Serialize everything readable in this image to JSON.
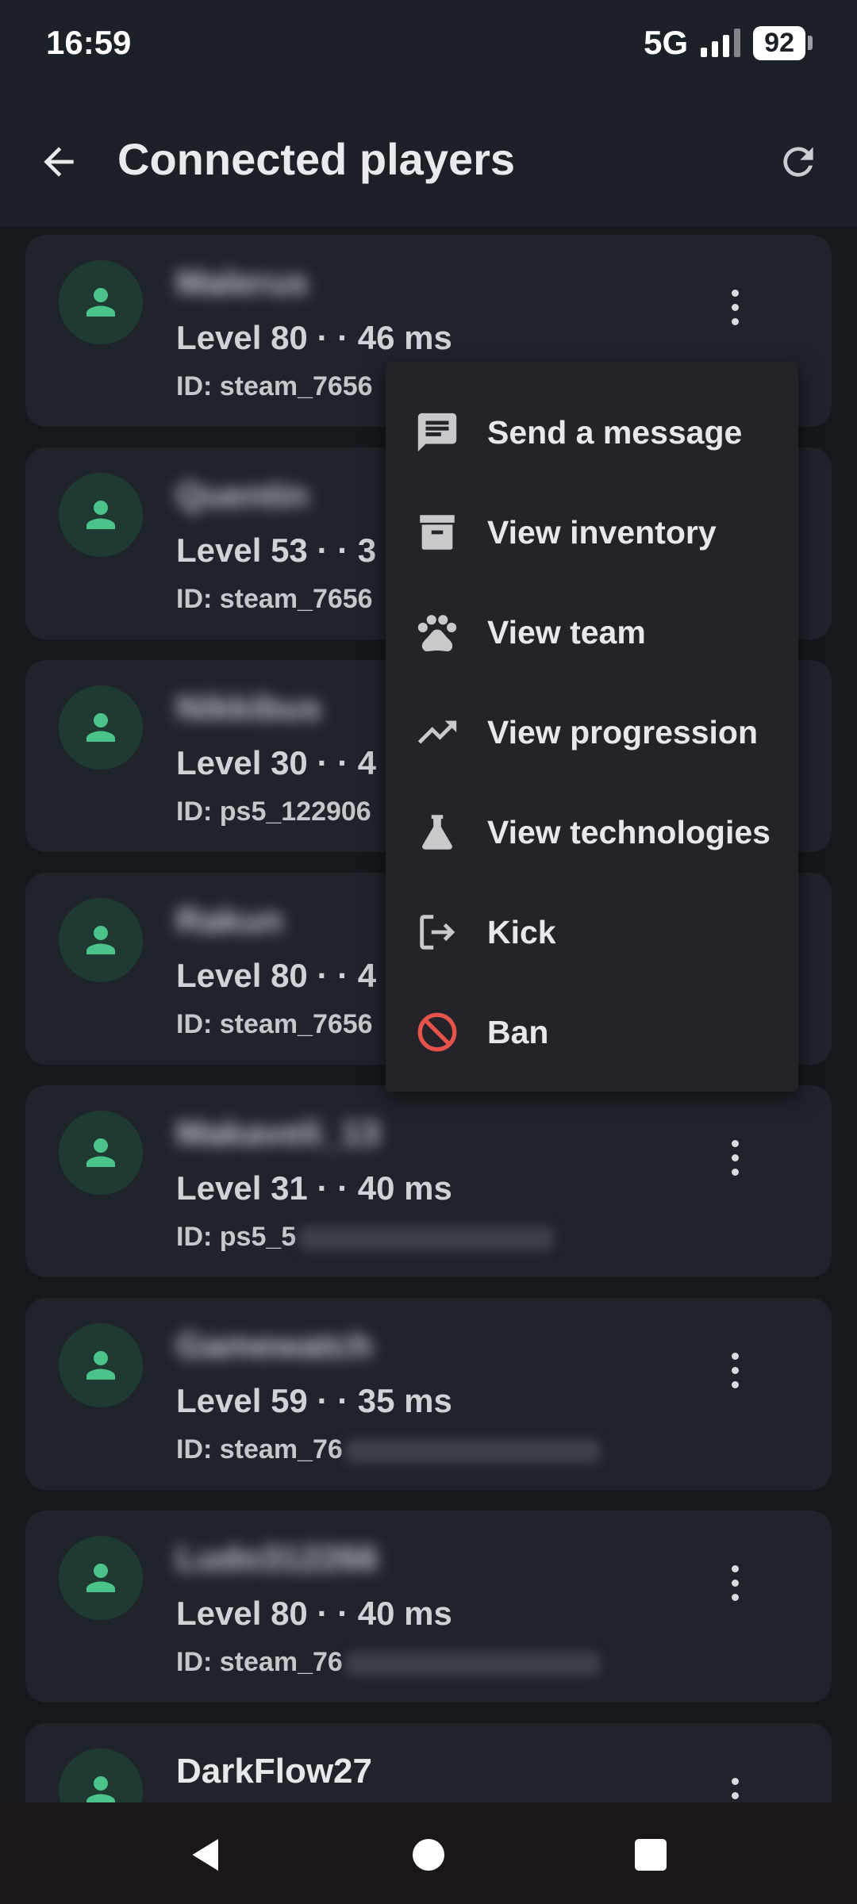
{
  "status": {
    "time": "16:59",
    "network": "5G",
    "battery": "92"
  },
  "app_bar": {
    "title": "Connected players",
    "back_icon": "arrow-left-icon",
    "refresh_icon": "refresh-icon"
  },
  "players": [
    {
      "name": "Malerus",
      "name_blurred": true,
      "level": "Level 80 ·",
      "ping": "· 46 ms",
      "id": "ID: steam_7656",
      "id_masked": false
    },
    {
      "name": "Quentin",
      "name_blurred": true,
      "level": "Level 53 ·",
      "ping": "· 3",
      "id": "ID: steam_7656",
      "id_masked": false
    },
    {
      "name": "Nikkibus",
      "name_blurred": true,
      "level": "Level 30 ·",
      "ping": "· 4",
      "id": "ID: ps5_122906",
      "id_masked": false
    },
    {
      "name": "Rakun",
      "name_blurred": true,
      "level": "Level 80 ·",
      "ping": "· 4",
      "id": "ID: steam_7656",
      "id_masked": false
    },
    {
      "name": "Makaveli_13",
      "name_blurred": true,
      "level": "Level 31 ·",
      "ping": "· 40 ms",
      "id": "ID: ps5_5",
      "id_masked": true
    },
    {
      "name": "Gamewatch",
      "name_blurred": true,
      "level": "Level 59 ·",
      "ping": "· 35 ms",
      "id": "ID: steam_76",
      "id_masked": true
    },
    {
      "name": "Ludo312266",
      "name_blurred": true,
      "level": "Level 80 ·",
      "ping": "· 40 ms",
      "id": "ID: steam_76",
      "id_masked": true
    },
    {
      "name": "DarkFlow27",
      "name_blurred": false,
      "level": "",
      "ping": "",
      "id": "",
      "id_masked": false
    }
  ],
  "menu": {
    "items": [
      {
        "label": "Send a message",
        "icon": "message-icon"
      },
      {
        "label": "View inventory",
        "icon": "archive-box-icon"
      },
      {
        "label": "View team",
        "icon": "paw-icon"
      },
      {
        "label": "View progression",
        "icon": "trending-up-icon"
      },
      {
        "label": "View technologies",
        "icon": "flask-icon"
      },
      {
        "label": "Kick",
        "icon": "logout-icon"
      },
      {
        "label": "Ban",
        "icon": "block-icon",
        "color": "#e5534b"
      }
    ]
  },
  "colors": {
    "accent": "#4cc38a",
    "danger": "#e5534b"
  },
  "nav": {
    "back": "nav-back-icon",
    "home": "nav-home-icon",
    "recents": "nav-recents-icon"
  }
}
